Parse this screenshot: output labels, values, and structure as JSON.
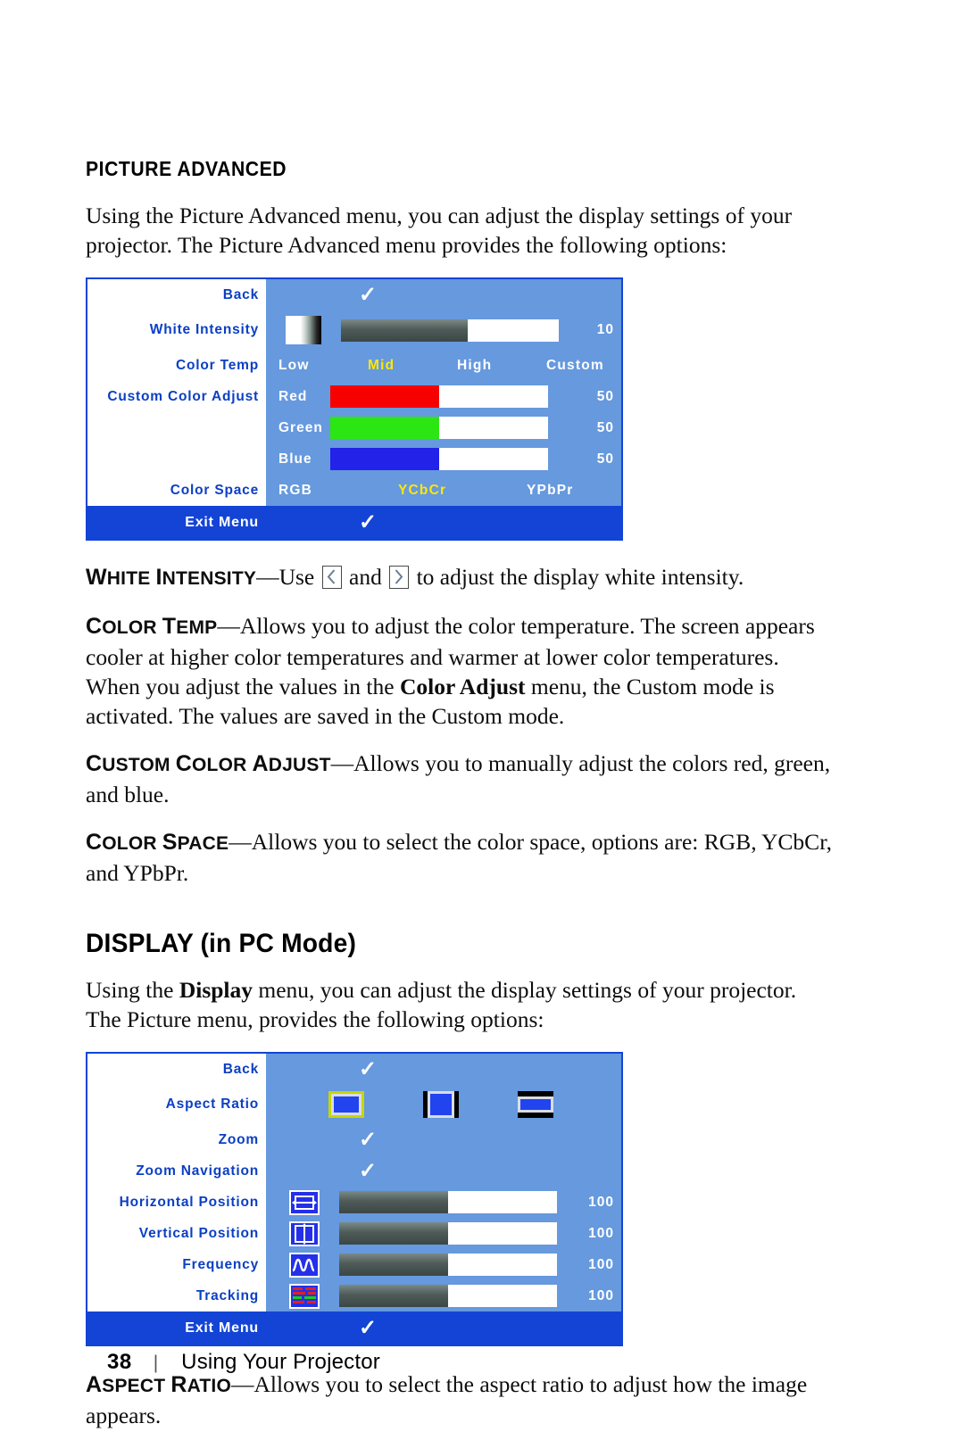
{
  "page": {
    "number": "38",
    "separator": "|",
    "footer_title": "Using Your Projector"
  },
  "sections": {
    "picture_advanced": {
      "heading": "PICTURE ADVANCED",
      "intro": "Using the Picture Advanced menu, you can adjust the display settings of your projector. The Picture Advanced menu provides the following options:"
    },
    "display_pc": {
      "heading": "DISPLAY (in PC Mode)",
      "intro_before": "Using the ",
      "intro_bold": "Display",
      "intro_after": " menu, you can adjust the display settings of your projector. The Picture menu, provides the following options:"
    }
  },
  "osd_picture_advanced": {
    "left_labels": [
      "Back",
      "White Intensity",
      "Color Temp",
      "Custom Color Adjust",
      "Color Space"
    ],
    "rows": {
      "back": {
        "label": "Back",
        "check": "✓"
      },
      "white_intensity": {
        "label": "White Intensity",
        "icon": "white-gradient-icon",
        "value": "10",
        "fill_percent": 58
      },
      "color_temp": {
        "label": "Color Temp",
        "options": [
          "Low",
          "Mid",
          "High",
          "Custom"
        ],
        "selected": "Mid"
      },
      "custom_color_adjust": {
        "label": "Custom Color Adjust",
        "channels": [
          {
            "name": "Red",
            "value": "50",
            "fill_percent": 50,
            "color": "#f60000"
          },
          {
            "name": "Green",
            "value": "50",
            "fill_percent": 50,
            "color": "#2ce614"
          },
          {
            "name": "Blue",
            "value": "50",
            "fill_percent": 50,
            "color": "#2222e8"
          }
        ]
      },
      "color_space": {
        "label": "Color Space",
        "options": [
          "RGB",
          "YCbCr",
          "YPbPr"
        ],
        "selected": "YCbCr"
      }
    },
    "exit": {
      "label": "Exit Menu",
      "check": "✓"
    }
  },
  "osd_display": {
    "rows": {
      "back": {
        "label": "Back",
        "check": "✓"
      },
      "aspect_ratio": {
        "label": "Aspect Ratio",
        "icons": [
          "aspect-ratio-original-icon",
          "aspect-ratio-4x3-icon",
          "aspect-ratio-16x9-icon"
        ],
        "selected_index": 0
      },
      "zoom": {
        "label": "Zoom",
        "check": "✓"
      },
      "zoom_navigation": {
        "label": "Zoom Navigation",
        "check": "✓"
      },
      "horizontal_position": {
        "label": "Horizontal Position",
        "icon": "horizontal-position-icon",
        "value": "100",
        "fill_percent": 50
      },
      "vertical_position": {
        "label": "Vertical Position",
        "icon": "vertical-position-icon",
        "value": "100",
        "fill_percent": 50
      },
      "frequency": {
        "label": "Frequency",
        "icon": "frequency-icon",
        "value": "100",
        "fill_percent": 50
      },
      "tracking": {
        "label": "Tracking",
        "icon": "tracking-icon",
        "value": "100",
        "fill_percent": 50
      }
    },
    "exit": {
      "label": "Exit Menu",
      "check": "✓"
    }
  },
  "definitions": {
    "white_intensity": {
      "term": "White Intensity",
      "text_a": "Use ",
      "text_b": " and ",
      "text_c": " to adjust the display white intensity."
    },
    "color_temp": {
      "term": "Color Temp",
      "text_a": "Allows you to adjust the color temperature. The screen appears cooler at higher color temperatures and warmer at lower color temperatures. When you adjust the values in the ",
      "bold": "Color Adjust",
      "text_b": " menu, the Custom mode is activated. The values are saved in the Custom mode."
    },
    "custom_color_adjust": {
      "term": "Custom Color Adjust",
      "text": "Allows you to manually adjust the colors red, green, and blue."
    },
    "color_space": {
      "term": "Color Space",
      "text": "Allows you to select the color space, options are: RGB, YCbCr, and YPbPr."
    },
    "aspect_ratio": {
      "term": "Aspect Ratio",
      "text": "Allows you to select the aspect ratio to adjust how the image appears."
    }
  },
  "colors": {
    "osd_panel": "#6699de",
    "osd_border": "#1344d6",
    "osd_exit_bar": "#1344d6",
    "osd_label_blue": "#0b3fc4",
    "osd_selected_yellow": "#ffe800"
  }
}
